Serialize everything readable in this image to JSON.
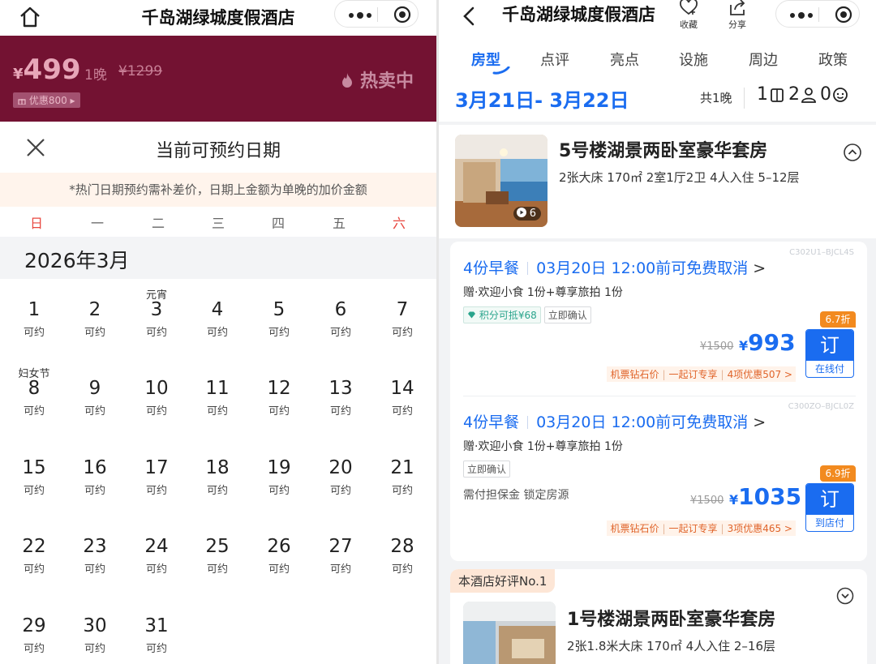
{
  "left": {
    "nav": {
      "title": "千岛湖绿城度假酒店"
    },
    "promo": {
      "currency": "¥",
      "price": "499",
      "per_night": "1晚",
      "orig_price": "¥1299",
      "coupon": "优惠800 ▸",
      "hot": "热卖中"
    },
    "sheet": {
      "title": "当前可预约日期",
      "notice": "*热门日期预约需补差价，日期上金额为单晚的加价金额",
      "weekdays": [
        "日",
        "一",
        "二",
        "三",
        "四",
        "五",
        "六"
      ],
      "month": "2026年3月",
      "days": [
        {
          "d": "1",
          "s": "可约",
          "h": ""
        },
        {
          "d": "2",
          "s": "可约",
          "h": ""
        },
        {
          "d": "3",
          "s": "可约",
          "h": "元宵"
        },
        {
          "d": "4",
          "s": "可约",
          "h": ""
        },
        {
          "d": "5",
          "s": "可约",
          "h": ""
        },
        {
          "d": "6",
          "s": "可约",
          "h": ""
        },
        {
          "d": "7",
          "s": "可约",
          "h": ""
        },
        {
          "d": "8",
          "s": "可约",
          "h": "妇女节"
        },
        {
          "d": "9",
          "s": "可约",
          "h": ""
        },
        {
          "d": "10",
          "s": "可约",
          "h": ""
        },
        {
          "d": "11",
          "s": "可约",
          "h": ""
        },
        {
          "d": "12",
          "s": "可约",
          "h": ""
        },
        {
          "d": "13",
          "s": "可约",
          "h": ""
        },
        {
          "d": "14",
          "s": "可约",
          "h": ""
        },
        {
          "d": "15",
          "s": "可约",
          "h": ""
        },
        {
          "d": "16",
          "s": "可约",
          "h": ""
        },
        {
          "d": "17",
          "s": "可约",
          "h": ""
        },
        {
          "d": "18",
          "s": "可约",
          "h": ""
        },
        {
          "d": "19",
          "s": "可约",
          "h": ""
        },
        {
          "d": "20",
          "s": "可约",
          "h": ""
        },
        {
          "d": "21",
          "s": "可约",
          "h": ""
        },
        {
          "d": "22",
          "s": "可约",
          "h": ""
        },
        {
          "d": "23",
          "s": "可约",
          "h": ""
        },
        {
          "d": "24",
          "s": "可约",
          "h": ""
        },
        {
          "d": "25",
          "s": "可约",
          "h": ""
        },
        {
          "d": "26",
          "s": "可约",
          "h": ""
        },
        {
          "d": "27",
          "s": "可约",
          "h": ""
        },
        {
          "d": "28",
          "s": "可约",
          "h": ""
        },
        {
          "d": "29",
          "s": "可约",
          "h": ""
        },
        {
          "d": "30",
          "s": "可约",
          "h": ""
        },
        {
          "d": "31",
          "s": "可约",
          "h": ""
        }
      ]
    }
  },
  "right": {
    "nav": {
      "title": "千岛湖绿城度假酒店",
      "favorite": "收藏",
      "share": "分享"
    },
    "tabs": [
      "房型",
      "点评",
      "亮点",
      "设施",
      "周边",
      "政策"
    ],
    "datebar": {
      "dates": "3月21日- 3月22日",
      "nights": "共1晚",
      "rooms": "1",
      "adults": "2",
      "children": "0"
    },
    "room1": {
      "name": "5号楼湖景两卧室豪华套房",
      "spec": "2张大床 170㎡ 2室1厅2卫 4人入住 5–12层",
      "media_count": "6"
    },
    "rates": [
      {
        "code": "C302U1–BJCL4S",
        "meal": "4份早餐",
        "cancel": "03月20日 12:00前可免费取消",
        "gift": "赠·欢迎小食 1份+尊享旅拍 1份",
        "tag_points": "积分可抵¥68",
        "tag_confirm": "立即确认",
        "guarantee": "",
        "discount": "6.7折",
        "orig_price": "¥1500",
        "currency": "¥",
        "price": "993",
        "book_label": "订",
        "pay_type": "在线付",
        "offer_a": "机票钻石价",
        "offer_b": "一起订专享",
        "offer_c": "4项优惠507 >"
      },
      {
        "code": "C300ZO–BJCL0Z",
        "meal": "4份早餐",
        "cancel": "03月20日 12:00前可免费取消",
        "gift": "赠·欢迎小食 1份+尊享旅拍 1份",
        "tag_confirm": "立即确认",
        "guarantee": "需付担保金 锁定房源",
        "discount": "6.9折",
        "orig_price": "¥1500",
        "currency": "¥",
        "price": "1035",
        "book_label": "订",
        "pay_type": "到店付",
        "offer_a": "机票钻石价",
        "offer_b": "一起订专享",
        "offer_c": "3项优惠465 >"
      }
    ],
    "room2": {
      "badge": "本酒店好评No.1",
      "name": "1号楼湖景两卧室豪华套房",
      "spec": "2张1.8米大床 170㎡ 4人入住 2–16层"
    }
  },
  "colors": {
    "accent": "#1a6cf0",
    "promo_bg": "#731232",
    "orange": "#f28a1f",
    "notice_bg": "#fff4ec"
  },
  "icons": [
    "home-icon",
    "more-dots-icon",
    "target-icon",
    "close-icon",
    "back-icon",
    "favorite-icon",
    "share-icon",
    "collapse-icon",
    "expand-icon",
    "bed-icon",
    "adult-icon",
    "child-icon",
    "flame-icon",
    "play-icon",
    "diamond-icon"
  ]
}
